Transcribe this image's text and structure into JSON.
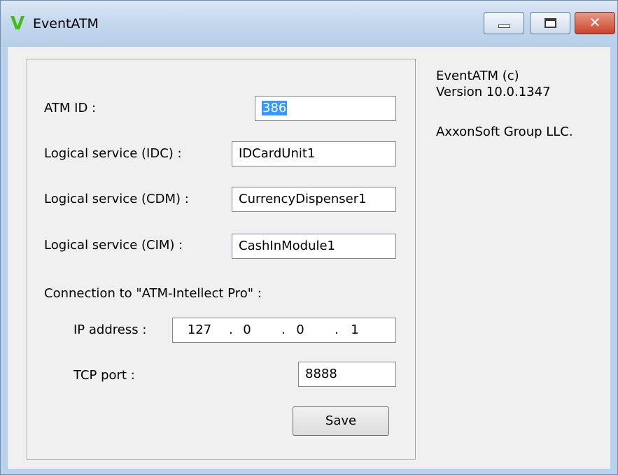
{
  "window": {
    "title": "EventATM",
    "icon_glyph": "V",
    "icon": "app-logo-icon",
    "accent_icon_color": "#3fbf10",
    "controls": {
      "minimize_icon": "minimize-icon",
      "maximize_icon": "maximize-icon",
      "close_glyph": "✕"
    }
  },
  "form": {
    "atm_id": {
      "label": "ATM ID :",
      "value": "386"
    },
    "idc": {
      "label": "Logical service (IDC) :",
      "value": "IDCardUnit1"
    },
    "cdm": {
      "label": "Logical service (CDM) :",
      "value": "CurrencyDispenser1"
    },
    "cim": {
      "label": "Logical service (CIM) :",
      "value": "CashInModule1"
    },
    "connection": {
      "heading": "Connection to \"ATM-Intellect Pro\" :",
      "ip_label": "IP address :",
      "ip": [
        "127",
        "0",
        "0",
        "1"
      ],
      "ip_separator": ".",
      "port_label": "TCP port :",
      "port": "8888"
    },
    "save_label": "Save"
  },
  "about": {
    "product": "EventATM (c)",
    "version": "Version 10.0.1347",
    "company": "AxxonSoft Group LLC."
  }
}
